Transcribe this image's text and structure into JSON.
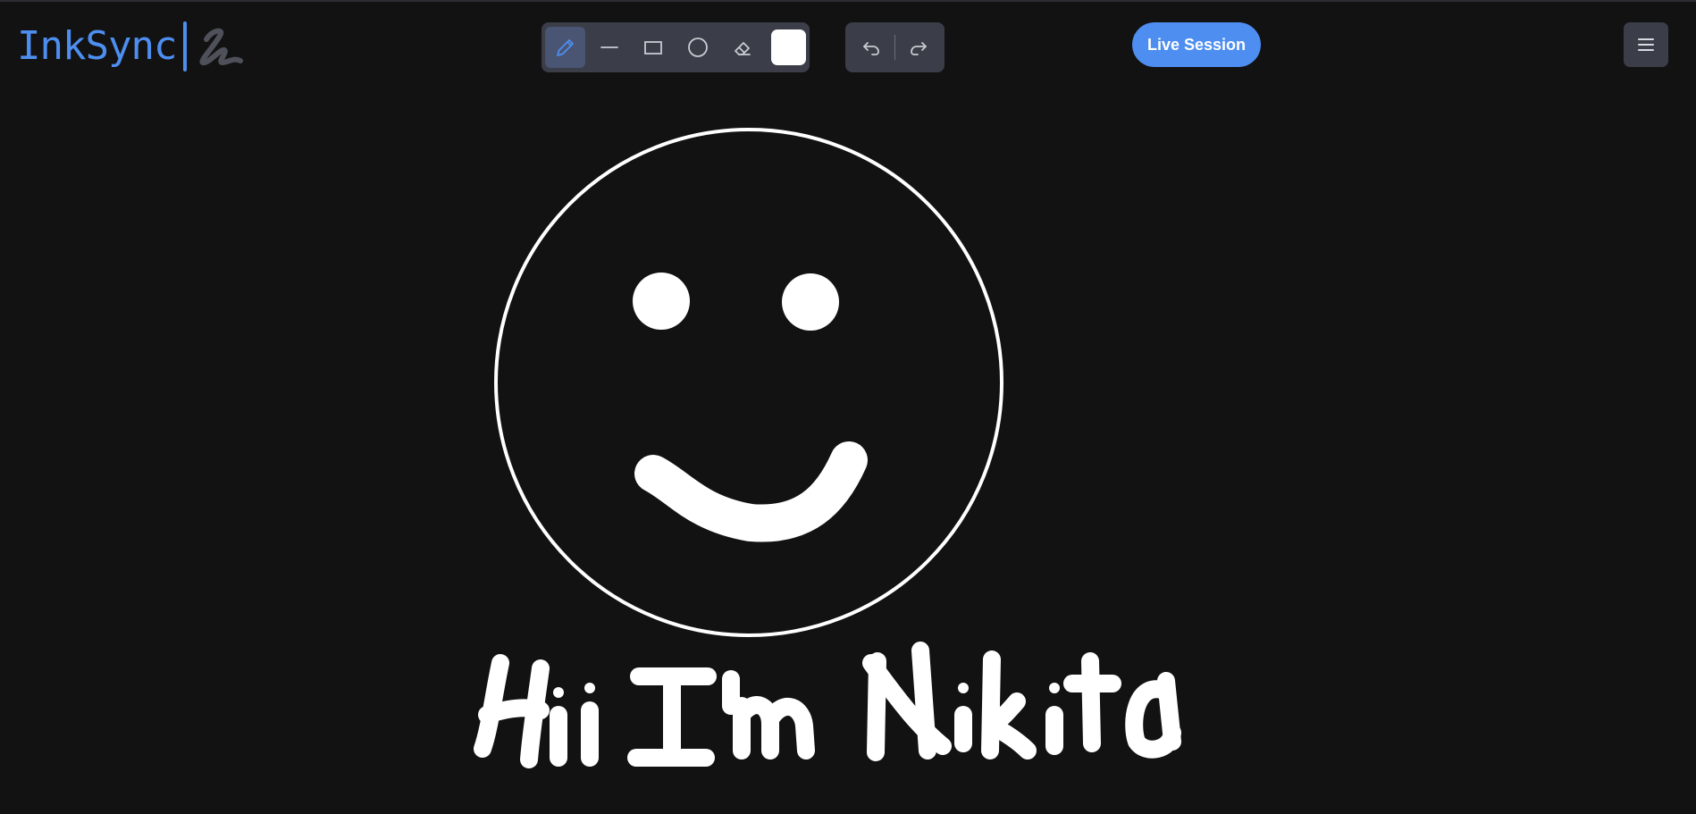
{
  "app": {
    "brand": "InkSync",
    "brand_color": "#4d8ef0",
    "canvas_background": "#121212"
  },
  "toolbar": {
    "tools": [
      {
        "name": "pencil",
        "icon": "pencil-icon",
        "active": true
      },
      {
        "name": "line",
        "icon": "line-icon",
        "active": false
      },
      {
        "name": "rectangle",
        "icon": "rectangle-icon",
        "active": false
      },
      {
        "name": "circle",
        "icon": "circle-icon",
        "active": false
      },
      {
        "name": "eraser",
        "icon": "eraser-icon",
        "active": false
      }
    ],
    "selected_color": "#ffffff"
  },
  "history": {
    "undo_icon": "undo-icon",
    "redo_icon": "redo-icon"
  },
  "session": {
    "live_label": "Live Session"
  },
  "menu": {
    "icon": "hamburger-menu-icon"
  },
  "drawing": {
    "stroke_color": "#ffffff",
    "handwritten_text": "Hii I'm Nikita"
  }
}
